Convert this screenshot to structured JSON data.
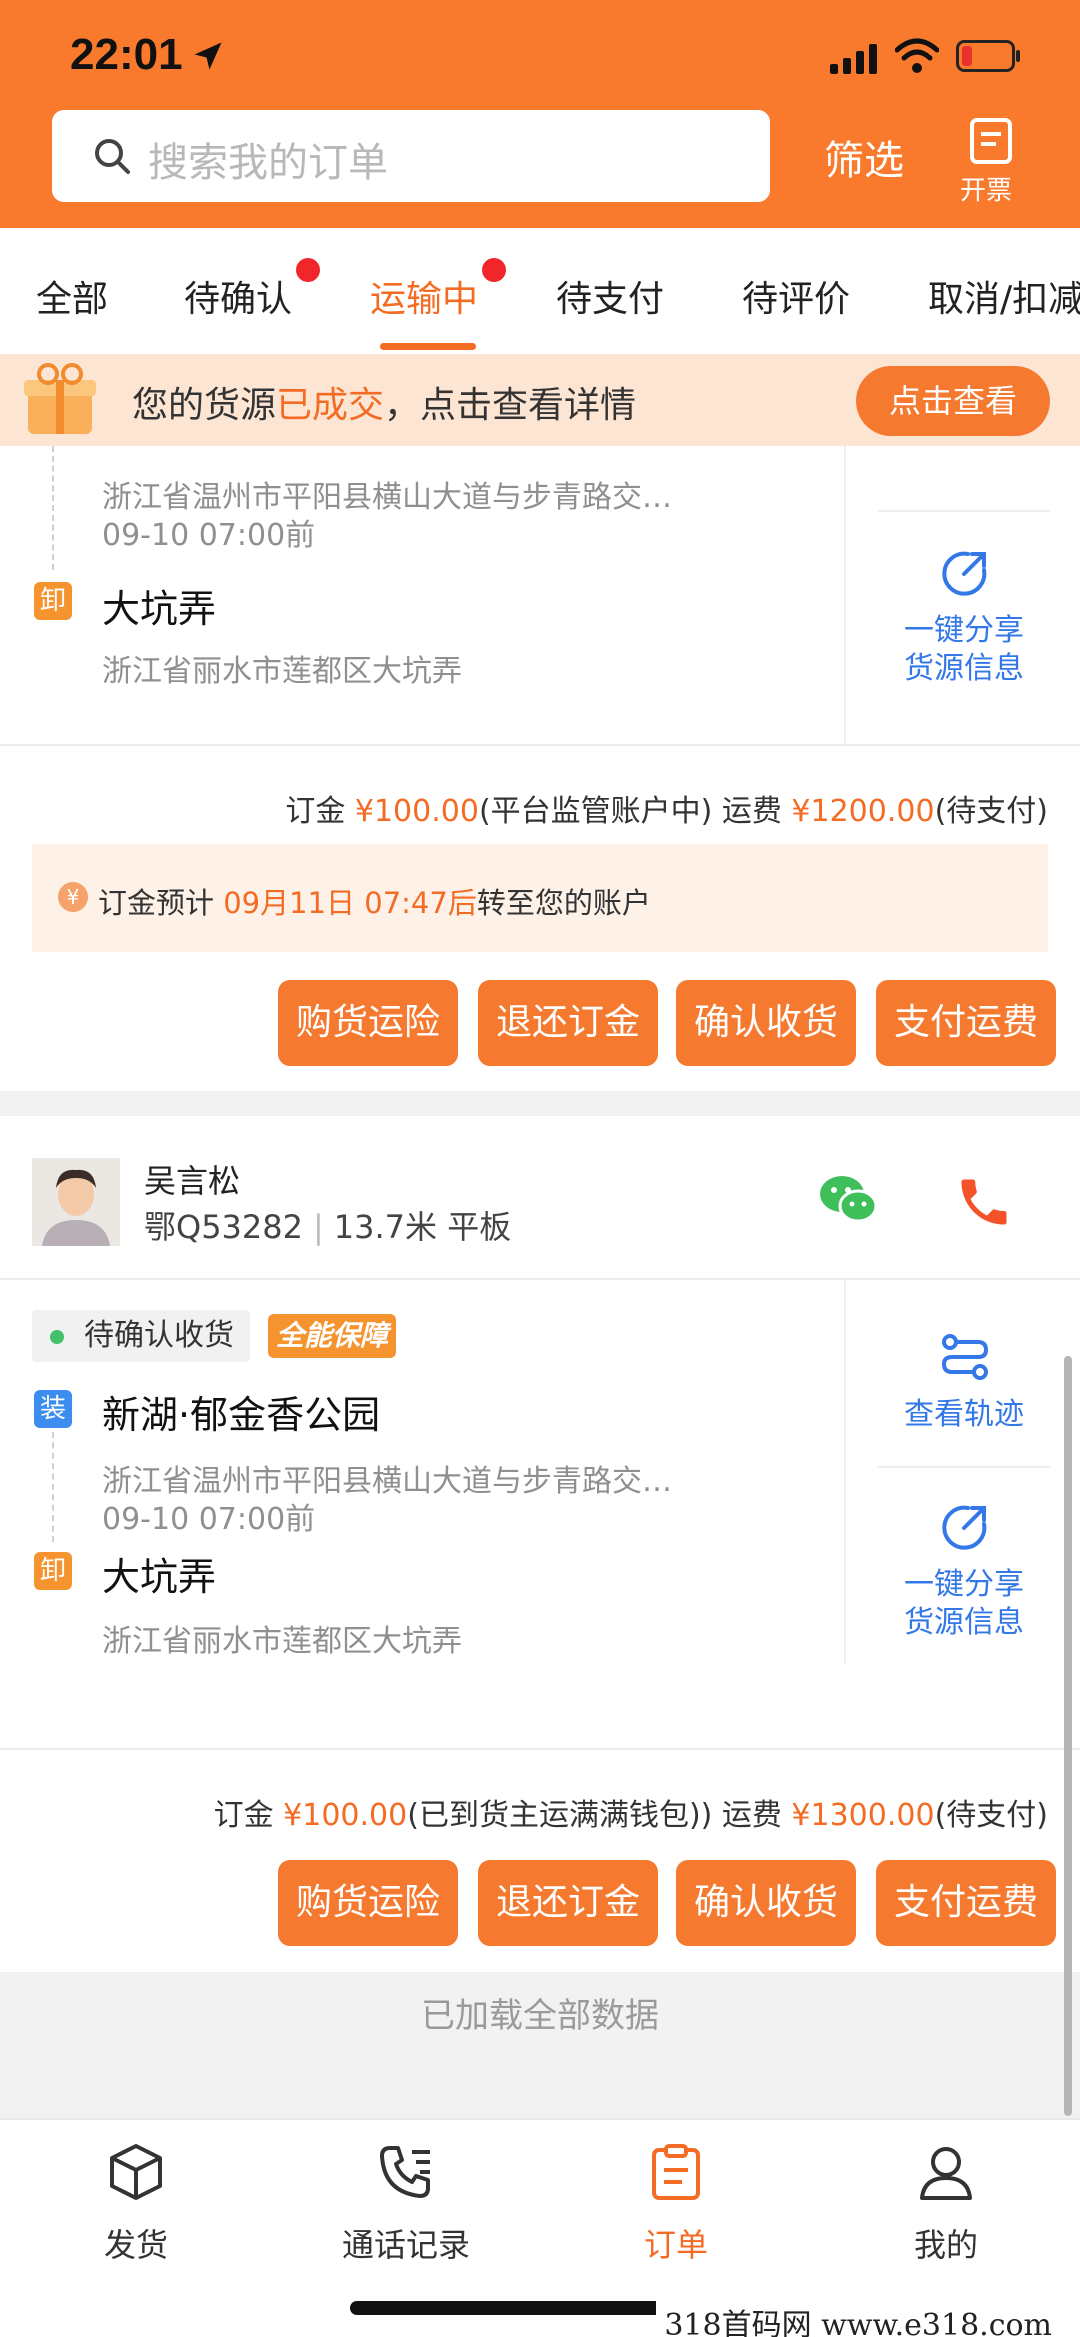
{
  "status_bar": {
    "time": "22:01"
  },
  "search": {
    "placeholder": "搜索我的订单"
  },
  "header": {
    "filter_label": "筛选",
    "invoice_label": "开票"
  },
  "tabs": [
    {
      "label": "全部"
    },
    {
      "label": "待确认"
    },
    {
      "label": "运输中"
    },
    {
      "label": "待支付"
    },
    {
      "label": "待评价"
    },
    {
      "label": "取消/扣减"
    }
  ],
  "banner": {
    "text_prefix": "您的货源",
    "text_highlight": "已成交",
    "text_suffix": "，点击查看详情",
    "button": "点击查看"
  },
  "order1": {
    "load_address_detail": "浙江省温州市平阳县横山大道与步青路交…",
    "load_time": "09-10 07:00前",
    "unload_tag": "卸",
    "unload_name": "大坑弄",
    "unload_address_detail": "浙江省丽水市莲都区大坑弄",
    "share_label_1": "一键分享",
    "share_label_2": "货源信息",
    "fee": {
      "deposit_label": "订金 ",
      "deposit_amount": "¥100.00",
      "deposit_note": "(平台监管账户中) 运费 ",
      "freight_amount": "¥1200.00",
      "freight_note": "(待支付)"
    },
    "notice": {
      "icon": "¥",
      "prefix": "订金预计 ",
      "time": "09月11日 07:47后",
      "suffix": "转至您的账户"
    },
    "buttons": [
      "购货运险",
      "退还订金",
      "确认收货",
      "支付运费"
    ]
  },
  "driver": {
    "name": "吴言松",
    "plate": "鄂Q53282",
    "sep": "|",
    "spec": "13.7米 平板"
  },
  "order2": {
    "status": "待确认收货",
    "badge": "全能保障",
    "load_tag": "装",
    "load_name": "新湖·郁金香公园",
    "load_address_detail": "浙江省温州市平阳县横山大道与步青路交…",
    "load_time": "09-10 07:00前",
    "unload_tag": "卸",
    "unload_name": "大坑弄",
    "unload_address_detail": "浙江省丽水市莲都区大坑弄",
    "track_label": "查看轨迹",
    "share_label_1": "一键分享",
    "share_label_2": "货源信息",
    "fee": {
      "deposit_label": "订金 ",
      "deposit_amount": "¥100.00",
      "deposit_note": "(已到货主运满满钱包)) 运费 ",
      "freight_amount": "¥1300.00",
      "freight_note": "(待支付)"
    },
    "buttons": [
      "购货运险",
      "退还订金",
      "确认收货",
      "支付运费"
    ]
  },
  "footer": {
    "loaded_all": "已加载全部数据"
  },
  "bottom_nav": [
    {
      "label": "发货"
    },
    {
      "label": "通话记录"
    },
    {
      "label": "订单"
    },
    {
      "label": "我的"
    }
  ],
  "watermark": "318首码网 www.e318.com",
  "colors": {
    "brand_orange": "#fa7a2d",
    "accent_blue": "#3478e8",
    "badge_red": "#f0262b"
  }
}
